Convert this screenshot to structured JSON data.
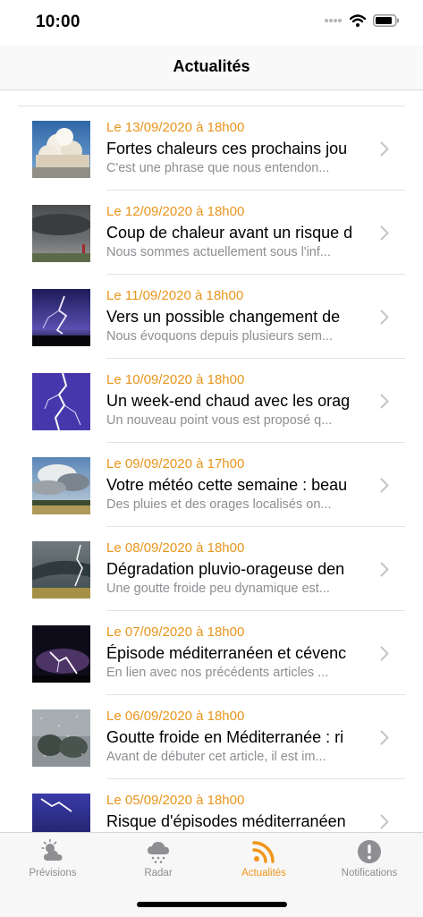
{
  "status": {
    "time": "10:00"
  },
  "nav": {
    "title": "Actualités"
  },
  "colors": {
    "accent": "#e8951c",
    "subtitle": "#8e8e93"
  },
  "articles": [
    {
      "date": "Le 13/09/2020 à 18h00",
      "title": "Fortes chaleurs ces prochains jou",
      "excerpt": "C'est une phrase que nous entendon...",
      "image": "cumulus-clouds"
    },
    {
      "date": "Le 12/09/2020 à 18h00",
      "title": "Coup de chaleur avant un risque d",
      "excerpt": "Nous sommes actuellement sous l'inf...",
      "image": "storm-sky"
    },
    {
      "date": "Le 11/09/2020 à 18h00",
      "title": "Vers un possible changement de",
      "excerpt": "Nous évoquons depuis plusieurs sem...",
      "image": "lightning-purple"
    },
    {
      "date": "Le 10/09/2020 à 18h00",
      "title": "Un week-end chaud avec les orag",
      "excerpt": "Un nouveau point vous est proposé q...",
      "image": "lightning-bolt"
    },
    {
      "date": "Le 09/09/2020 à 17h00",
      "title": "Votre météo cette semaine : beau",
      "excerpt": "Des pluies et des orages localisés on...",
      "image": "field-clouds"
    },
    {
      "date": "Le 08/09/2020 à 18h00",
      "title": "Dégradation pluvio-orageuse den",
      "excerpt": "Une goutte froide peu dynamique est...",
      "image": "storm-field"
    },
    {
      "date": "Le 07/09/2020 à 18h00",
      "title": "Épisode méditerranéen et cévenc",
      "excerpt": "En lien avec nos précédents articles ...",
      "image": "lightning-night"
    },
    {
      "date": "Le 06/09/2020 à 18h00",
      "title": "Goutte froide en Méditerranée : ri",
      "excerpt": "Avant de débuter cet article, il est im...",
      "image": "rain-window"
    },
    {
      "date": "Le 05/09/2020 à 18h00",
      "title": "Risque d'épisodes méditerranéen",
      "excerpt": "",
      "image": "lightning-blue"
    }
  ],
  "tabs": [
    {
      "label": "Prévisions",
      "icon": "sun-cloud-icon",
      "active": false
    },
    {
      "label": "Radar",
      "icon": "cloud-rain-icon",
      "active": false
    },
    {
      "label": "Actualités",
      "icon": "rss-icon",
      "active": true
    },
    {
      "label": "Notifications",
      "icon": "alert-icon",
      "active": false
    }
  ]
}
